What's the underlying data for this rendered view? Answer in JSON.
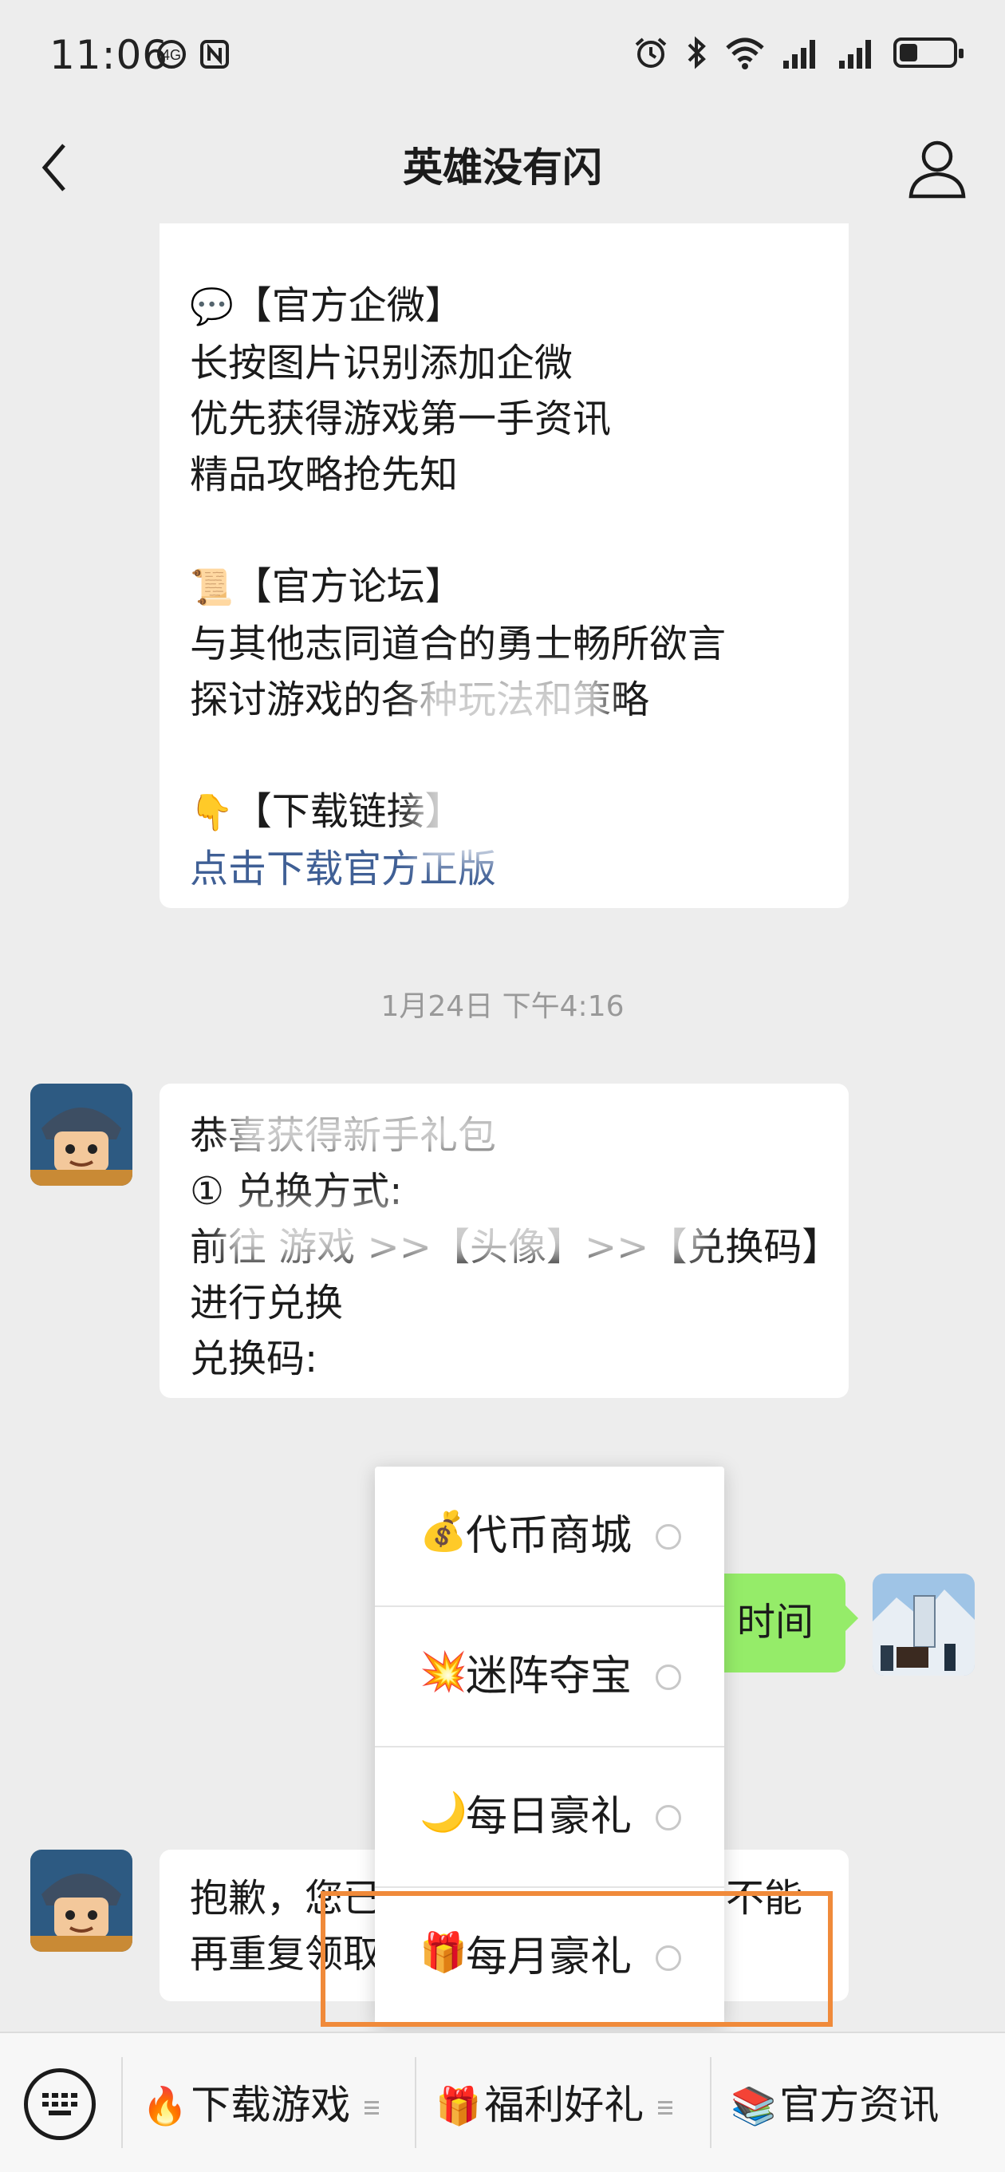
{
  "status_bar": {
    "time": "11:06",
    "left_icons": [
      "hd-call-icon",
      "nfc-icon"
    ],
    "right_icons": [
      "alarm-icon",
      "bluetooth-icon",
      "wifi-icon",
      "signal-icon",
      "signal-icon",
      "battery-icon"
    ],
    "battery_level": 0.35
  },
  "nav": {
    "title": "英雄没有闪",
    "back_icon": "chevron-left-icon",
    "profile_icon": "person-icon"
  },
  "messages": {
    "first": {
      "emoji1": "💬",
      "heading1": "【官方企微】",
      "lines1": [
        "长按图片识别添加企微",
        "优先获得游戏第一手资讯",
        "精品攻略抢先知"
      ],
      "emoji2": "📜",
      "heading2": "【官方论坛】",
      "lines2": [
        "与其他志同道合的勇士畅所欲言",
        "探讨游戏的各种玩法和策略"
      ],
      "emoji3": "👇",
      "heading3": "【下载链接】",
      "link": "点击下载官方正版"
    },
    "timestamp": "1月24日 下午4:16",
    "second": {
      "lines": [
        "恭喜获得新手礼包",
        "① 兑换方式:",
        "前往 游戏 >>【头像】>>【兑换码】",
        "进行兑换",
        "兑换码: "
      ]
    },
    "user_message": "时间",
    "third": {
      "lines": [
        "抱歉，您已经领取过该礼包了，不能",
        "再重复领取"
      ]
    }
  },
  "popup_menu": {
    "items": [
      {
        "emoji": "💰",
        "label": "代币商城",
        "icon": "mini-program-icon"
      },
      {
        "emoji": "💥",
        "label": "迷阵夺宝",
        "icon": "mini-program-icon"
      },
      {
        "emoji": "🌙",
        "label": "每日豪礼",
        "icon": "mini-program-icon"
      },
      {
        "emoji": "🎁",
        "label": "每月豪礼",
        "icon": "mini-program-icon"
      }
    ],
    "highlight_color": "#f08a3a"
  },
  "bottom_menu": {
    "keyboard_icon": "keyboard-icon",
    "items": [
      {
        "emoji": "🔥",
        "label": "下载游戏"
      },
      {
        "emoji": "🎁",
        "label": "福利好礼"
      },
      {
        "emoji": "📚",
        "label": "官方资讯"
      }
    ]
  },
  "colors": {
    "background": "#ededed",
    "user_bubble": "#95ec69",
    "link": "#3f5f95"
  }
}
